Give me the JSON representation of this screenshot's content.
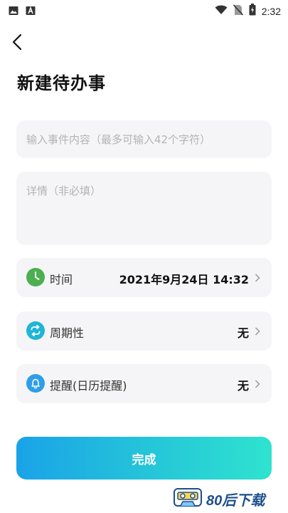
{
  "status_bar": {
    "time": "2:32",
    "icons": [
      "image-icon",
      "text-a-icon",
      "wifi-icon",
      "no-sim-icon",
      "battery-icon"
    ]
  },
  "header": {
    "back_icon": "back-arrow-icon",
    "title": "新建待办事"
  },
  "form": {
    "title_placeholder": "输入事件内容（最多可输入42个字符）",
    "detail_placeholder": "详情（非必填）"
  },
  "rows": {
    "time": {
      "label": "时间",
      "value": "2021年9月24日 14:32",
      "icon": "clock-icon",
      "icon_color": "#4caf50"
    },
    "repeat": {
      "label": "周期性",
      "value": "无",
      "icon": "repeat-icon",
      "icon_color": "#1fb5d6"
    },
    "remind": {
      "label": "提醒(日历提醒)",
      "value": "无",
      "icon": "bell-icon",
      "icon_color": "#2f9ee8"
    }
  },
  "done_button": {
    "label": "完成"
  },
  "watermark": {
    "text": "80后下载"
  },
  "colors": {
    "accent_start": "#1aa3e8",
    "accent_end": "#2fe3cf",
    "field_bg": "#f5f5f7"
  }
}
